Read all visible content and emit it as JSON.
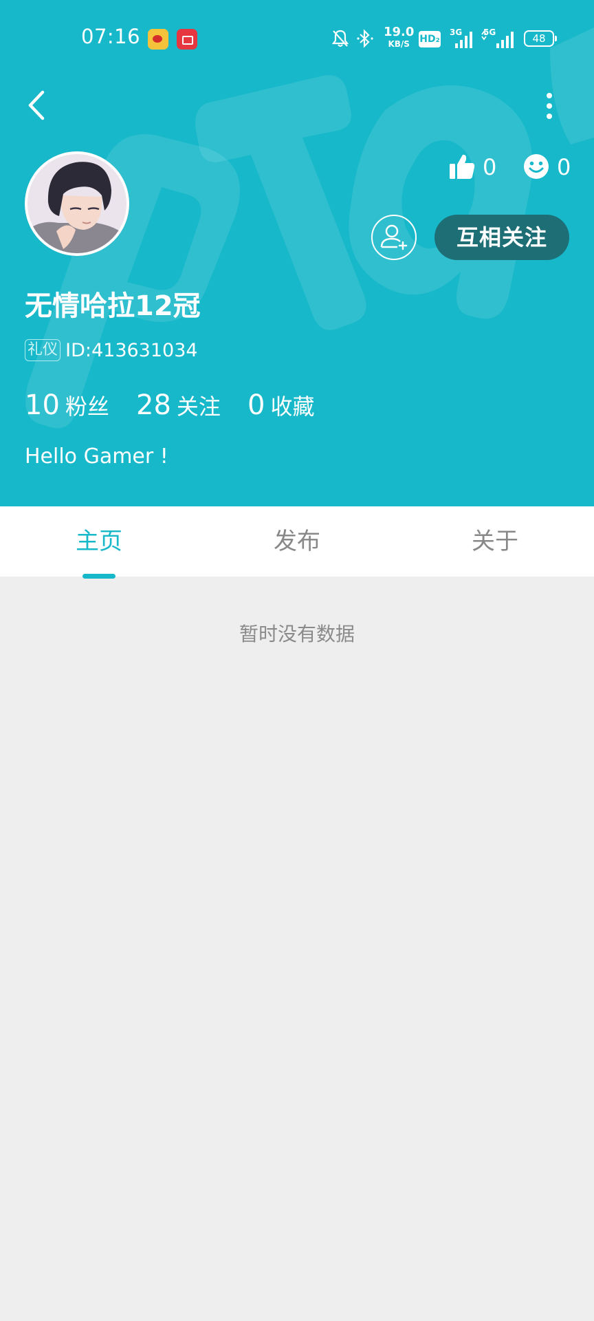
{
  "status_bar": {
    "time": "07:16",
    "net_speed_value": "19.0",
    "net_speed_unit": "KB/S",
    "hd_label": "HD₂",
    "battery": "48",
    "signal_1_label": "3G",
    "signal_2_label": "5G"
  },
  "profile": {
    "username": "无情哈拉12冠",
    "badge": "礼仪",
    "id_text": "ID:413631034",
    "likes": "0",
    "smiles": "0",
    "mutual_follow_label": "互相关注",
    "bio": "Hello Gamer !",
    "counts": [
      {
        "value": "10",
        "label": "粉丝"
      },
      {
        "value": "28",
        "label": "关注"
      },
      {
        "value": "0",
        "label": "收藏"
      }
    ]
  },
  "tabs": [
    {
      "label": "主页",
      "active": true
    },
    {
      "label": "发布",
      "active": false
    },
    {
      "label": "关于",
      "active": false
    }
  ],
  "empty_state": "暂时没有数据",
  "colors": {
    "accent": "#16b8c9",
    "mutual_button": "#1e6e76",
    "background": "#eeeeee"
  },
  "icons": [
    "back-icon",
    "more-icon",
    "thumbs-up-icon",
    "smile-icon",
    "add-friend-icon"
  ]
}
